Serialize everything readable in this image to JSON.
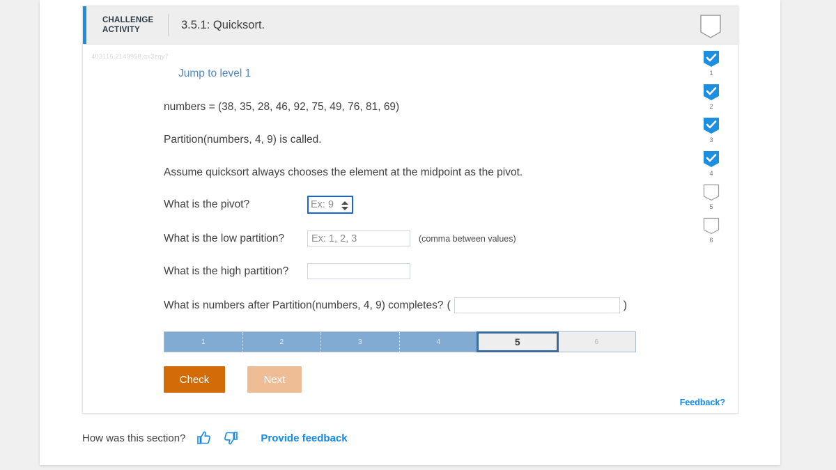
{
  "header": {
    "kicker": "CHALLENGE ACTIVITY",
    "title": "3.5.1: Quicksort.",
    "bookmark_icon": "bookmark-outline-icon"
  },
  "activity_id": "403116.2149958.qx3zqy7",
  "jump_link": "Jump to level 1",
  "statements": {
    "numbers": "numbers = (38, 35, 28, 46, 92, 75, 49, 76, 81, 69)",
    "partition_call": "Partition(numbers, 4, 9) is called.",
    "assumption": "Assume quicksort always chooses the element at the midpoint as the pivot."
  },
  "questions": {
    "pivot": {
      "label": "What is the pivot?",
      "value": "",
      "placeholder": "Ex: 9"
    },
    "low": {
      "label": "What is the low partition?",
      "value": "",
      "placeholder": "Ex: 1, 2, 3",
      "hint": "(comma between values)"
    },
    "high": {
      "label": "What is the high partition?",
      "value": "",
      "placeholder": ""
    },
    "final": {
      "label": "What is numbers after Partition(numbers, 4, 9) completes?",
      "open_paren": "(",
      "close_paren": ")",
      "value": "",
      "placeholder": ""
    }
  },
  "progress": {
    "steps": [
      {
        "label": "1",
        "state": "done"
      },
      {
        "label": "2",
        "state": "done"
      },
      {
        "label": "3",
        "state": "done"
      },
      {
        "label": "4",
        "state": "done"
      },
      {
        "label": "5",
        "state": "current"
      },
      {
        "label": "6",
        "state": "todo"
      }
    ]
  },
  "buttons": {
    "check": "Check",
    "next": "Next"
  },
  "badges": [
    {
      "number": "1",
      "state": "checked"
    },
    {
      "number": "2",
      "state": "checked"
    },
    {
      "number": "3",
      "state": "checked"
    },
    {
      "number": "4",
      "state": "checked"
    },
    {
      "number": "5",
      "state": "empty"
    },
    {
      "number": "6",
      "state": "empty"
    }
  ],
  "card_feedback_link": "Feedback?",
  "footer": {
    "question": "How was this section?",
    "thumbs_up_icon": "thumbs-up-icon",
    "thumbs_down_icon": "thumbs-down-icon",
    "provide_feedback": "Provide feedback"
  },
  "colors": {
    "accent_blue": "#1d8fe0",
    "link_blue": "#1289e8",
    "progress_fill": "#82abd4",
    "progress_current_border": "#3b6b9c",
    "check_orange": "#d36b06",
    "next_orange_disabled": "#eebd96",
    "focus_blue": "#1565d8",
    "page_bg": "#f0f0f0"
  }
}
